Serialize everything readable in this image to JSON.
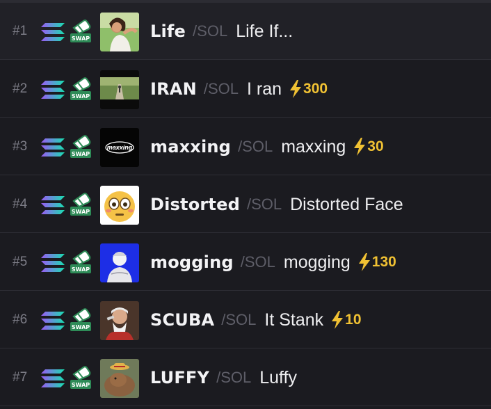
{
  "colors": {
    "background": "#1b1b20",
    "boost": "#f0c133",
    "swap_green": "#2e8b57"
  },
  "rows": [
    {
      "rank": "#1",
      "ticker": "Life",
      "pair": "/SOL",
      "name": "Life If...",
      "boost": null,
      "avatar": "smiling-woman-field-image"
    },
    {
      "rank": "#2",
      "ticker": "IRAN",
      "pair": "/SOL",
      "name": "I ran",
      "boost": "300",
      "avatar": "running-path-image"
    },
    {
      "rank": "#3",
      "ticker": "maxxing",
      "pair": "/SOL",
      "name": "maxxing",
      "boost": "30",
      "avatar": "maxxing-logo-image"
    },
    {
      "rank": "#4",
      "ticker": "Distorted",
      "pair": "/SOL",
      "name": "Distorted Face",
      "boost": null,
      "avatar": "flushed-face-emoji-image"
    },
    {
      "rank": "#5",
      "ticker": "mogging",
      "pair": "/SOL",
      "name": "mogging",
      "boost": "130",
      "avatar": "statue-blue-image"
    },
    {
      "rank": "#6",
      "ticker": "SCUBA",
      "pair": "/SOL",
      "name": "It Stank",
      "boost": "10",
      "avatar": "old-man-smoking-image"
    },
    {
      "rank": "#7",
      "ticker": "LUFFY",
      "pair": "/SOL",
      "name": "Luffy",
      "boost": null,
      "avatar": "capybara-straw-hat-image"
    }
  ],
  "icons": {
    "chain": "solana-icon",
    "swap": "swap-icon",
    "boost": "lightning-bolt-icon",
    "swap_label": "SWAP"
  }
}
